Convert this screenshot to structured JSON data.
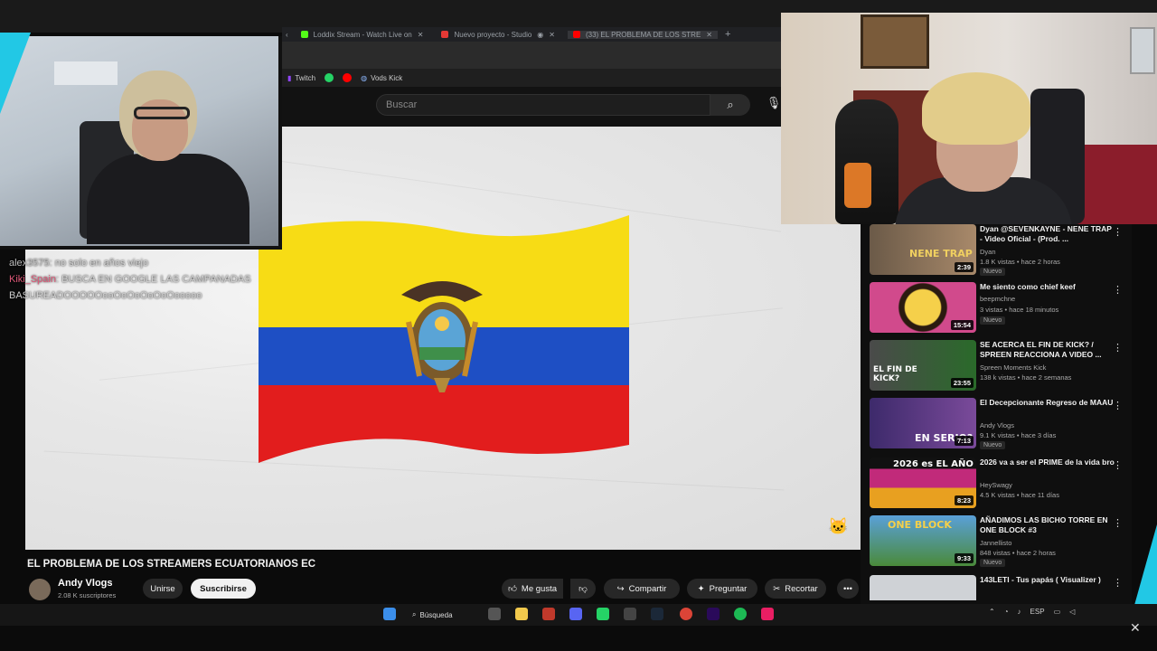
{
  "browser": {
    "tabs": [
      {
        "label": "Loddix Stream - Watch Live on",
        "color": "#53fc18"
      },
      {
        "label": "Nuevo proyecto - Studio",
        "color": "#e53935"
      },
      {
        "label": "(33) EL PROBLEMA DE LOS STRE",
        "color": "#ff0000"
      }
    ],
    "new_tab": "+",
    "bookmarks": [
      "Twitch",
      "Vods Kick"
    ]
  },
  "youtube": {
    "search_placeholder": "Buscar",
    "video_title": "EL PROBLEMA DE LOS STREAMERS ECUATORIANOS EC",
    "channel_name": "Andy Vlogs",
    "subscribers": "2.08 K suscriptores",
    "join_label": "Unirse",
    "subscribe_label": "Suscribirse",
    "like_label": "Me gusta",
    "share_label": "Compartir",
    "ask_label": "Preguntar",
    "clip_label": "Recortar",
    "more_label": "•••"
  },
  "chat_overlay": [
    {
      "user": "alex3575",
      "message": ": no solo en años viejo"
    },
    {
      "user": "Kiki_Spain",
      "message": ": BUSCA EN GOOGLE LAS CAMPANADAS"
    },
    {
      "user": "",
      "message": "BASUREADOOOOOooOoOoOoOoOooooo"
    }
  ],
  "recommendations": [
    {
      "title": "Dyan @SEVENKAYNE - NENE TRAP - Video Oficial - (Prod. ...",
      "channel": "Dyan",
      "meta": "1.8 K vistas • hace 2 horas",
      "badge": "Nuevo",
      "duration": "2:39",
      "thumb_text": "NENE TRAP",
      "thumb_bg": "#6b5a48"
    },
    {
      "title": "Me siento como chief keef",
      "channel": "beepmchne",
      "meta": "3 vistas • hace 18 minutos",
      "badge": "Nuevo",
      "duration": "15:54",
      "thumb_text": "",
      "thumb_bg": "#d14a8c"
    },
    {
      "title": "SE ACERCA EL FIN DE KICK? / SPREEN REACCIONA A VIDEO ...",
      "channel": "Spreen Moments Kick",
      "meta": "138 k vistas • hace 2 semanas",
      "badge": "",
      "duration": "23:55",
      "thumb_text": "EL FIN DE KICK?",
      "thumb_bg": "#3a5a3a"
    },
    {
      "title": "El Decepcionante Regreso de MAAU",
      "channel": "Andy Vlogs",
      "meta": "9.1 K vistas • hace 3 días",
      "badge": "Nuevo",
      "duration": "7:13",
      "thumb_text": "EN SERIO?",
      "thumb_bg": "#3d2a6b"
    },
    {
      "title": "2026 va a ser el PRIME de la vida bro",
      "channel": "HeySwagy",
      "meta": "4.5 K vistas • hace 11 días",
      "badge": "",
      "duration": "8:23",
      "thumb_text": "2026 es EL AÑO",
      "thumb_bg": "#c12a7a"
    },
    {
      "title": "AÑADIMOS LAS BICHO TORRE EN ONE BLOCK #3",
      "channel": "Jannellisto",
      "meta": "848 vistas • hace 2 horas",
      "badge": "Nuevo",
      "duration": "9:33",
      "thumb_text": "ONE BLOCK",
      "thumb_bg": "#4a8a3a"
    },
    {
      "title": "143LETI - Tus papás ( Visualizer )",
      "channel": "",
      "meta": "",
      "badge": "",
      "duration": "",
      "thumb_text": "",
      "thumb_bg": "#cfd2d6"
    }
  ],
  "taskbar": {
    "search_label": "Búsqueda",
    "lang": "ESP"
  }
}
